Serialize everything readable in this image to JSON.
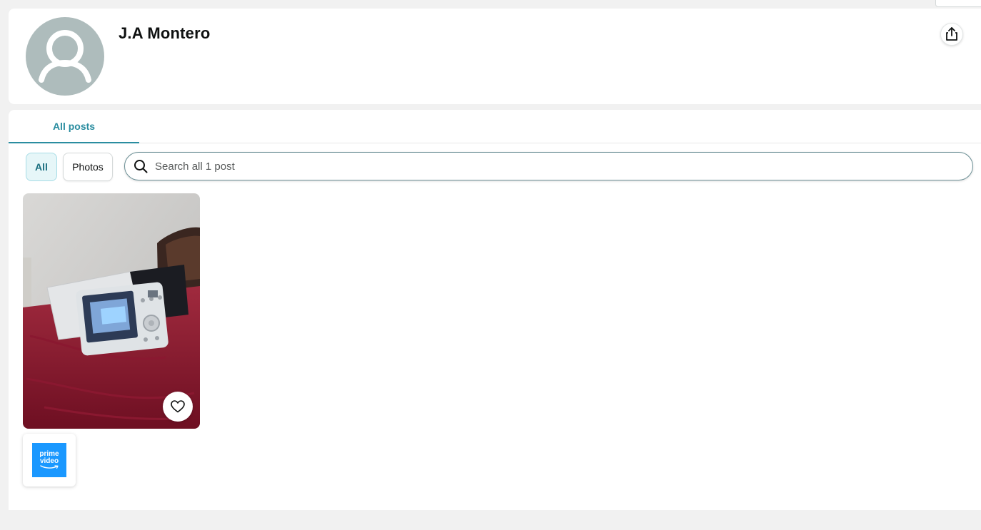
{
  "profile": {
    "name": "J.A Montero",
    "avatar_icon": "default-person-avatar",
    "share_icon": "share-icon"
  },
  "tabs": [
    {
      "label": "All posts",
      "active": true
    }
  ],
  "filters": {
    "all_label": "All",
    "photos_label": "Photos",
    "selected": "All"
  },
  "search": {
    "placeholder": "Search all 1 post",
    "value": ""
  },
  "posts": [
    {
      "type": "photo",
      "like_icon": "heart-outline-icon",
      "source_badge": {
        "icon": "prime-video-logo",
        "line1": "prime",
        "line2": "video",
        "color": "#1a98ff"
      }
    }
  ],
  "colors": {
    "accent": "#2a8da0",
    "page_background": "#f1f1f1",
    "avatar_background": "#aebcbc"
  }
}
